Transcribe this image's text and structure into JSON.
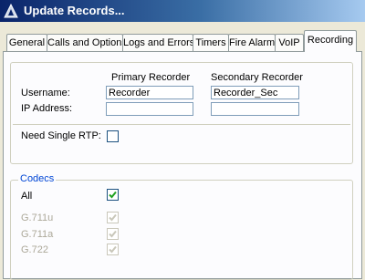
{
  "window": {
    "title": "Update Records..."
  },
  "tabs": [
    {
      "label": "General"
    },
    {
      "label": "Calls and Options"
    },
    {
      "label": "Logs and Errors"
    },
    {
      "label": "Timers"
    },
    {
      "label": "Fire Alarm"
    },
    {
      "label": "VoIP"
    },
    {
      "label": "Recording",
      "active": true
    }
  ],
  "recorders": {
    "primary_header": "Primary Recorder",
    "secondary_header": "Secondary Recorder",
    "username_label": "Username:",
    "ip_label": "IP Address:",
    "primary": {
      "username": "Recorder",
      "ip_address": ""
    },
    "secondary": {
      "username": "Recorder_Sec",
      "ip_address": ""
    }
  },
  "rtp": {
    "label": "Need Single RTP:",
    "checked": false
  },
  "codecs": {
    "legend": "Codecs",
    "all": {
      "label": "All",
      "checked": true
    },
    "items": [
      {
        "label": "G.711u",
        "checked": true,
        "disabled": true
      },
      {
        "label": "G.711a",
        "checked": true,
        "disabled": true
      },
      {
        "label": "G.722",
        "checked": true,
        "disabled": true
      }
    ]
  },
  "colors": {
    "accent": "#0a246a",
    "group_legend": "#0046d5",
    "check": "#21a121",
    "disabled_text": "#aca899"
  }
}
